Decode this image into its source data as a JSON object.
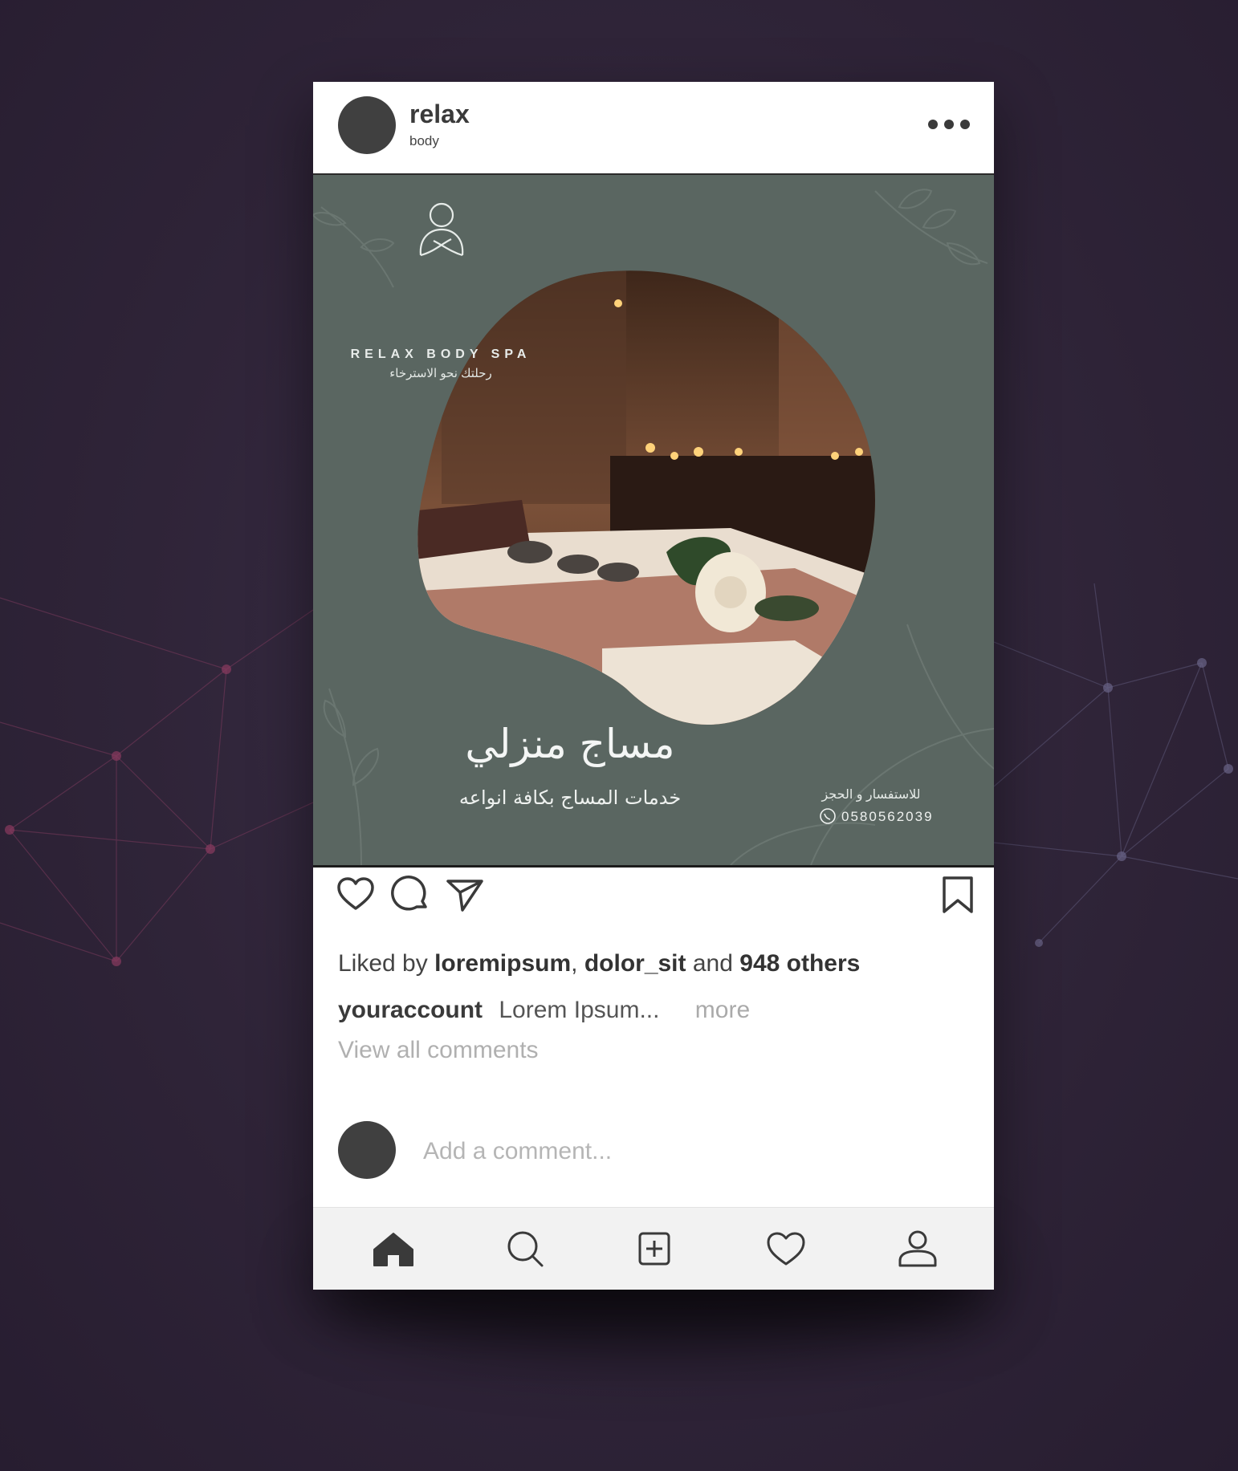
{
  "profile": {
    "username": "relax",
    "subtitle": "body",
    "more_icon": "more-dots-icon"
  },
  "post": {
    "brand_name": "RELAX BODY SPA",
    "brand_tagline": "رحلتك نحو الاسترخاء",
    "headline": "مساج منزلي",
    "subheadline": "خدمات المساج بكافة انواعه",
    "contact_label": "للاستفسار و الحجز",
    "phone": "0580562039",
    "colors": {
      "background": "#5a6661",
      "text": "#f4f6f5"
    }
  },
  "actions": {
    "like_icon": "heart-icon",
    "comment_icon": "comment-icon",
    "share_icon": "send-icon",
    "save_icon": "bookmark-icon"
  },
  "likes": {
    "prefix": "Liked by",
    "user1": "loremipsum",
    "separator": ",",
    "user2": "dolor_sit",
    "conjunction": "and",
    "others": "948 others"
  },
  "caption": {
    "account": "youraccount",
    "text": "Lorem Ipsum...",
    "more": "more"
  },
  "comments": {
    "view_all": "View all comments",
    "placeholder": "Add a comment..."
  },
  "bottom_nav": {
    "items": [
      "home-icon",
      "search-icon",
      "add-post-icon",
      "activity-heart-icon",
      "profile-icon"
    ]
  }
}
